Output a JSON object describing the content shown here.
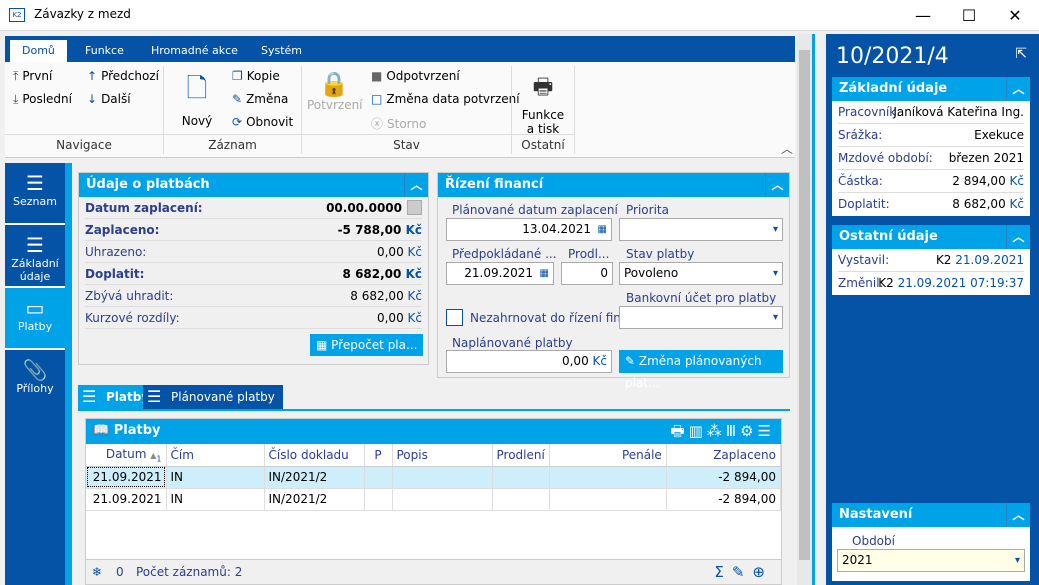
{
  "window": {
    "title": "Závazky z mezd",
    "minimize": "—",
    "maximize": "☐",
    "close": "✕"
  },
  "ribbon": {
    "tabs": [
      "Domů",
      "Funkce",
      "Hromadné akce",
      "Systém"
    ],
    "nav": {
      "first": "První",
      "last": "Poslední",
      "prev": "Předchozí",
      "next": "Další",
      "group": "Navigace"
    },
    "record": {
      "new": "Nový",
      "copy": "Kopie",
      "edit": "Změna",
      "refresh": "Obnovit",
      "group": "Záznam"
    },
    "state": {
      "confirm": "Potvrzení",
      "unconfirm": "Odpotvrzení",
      "change_date": "Změna data potvrzení",
      "cancel": "Storno",
      "group": "Stav"
    },
    "other": {
      "functions": "Funkce a tisk",
      "group": "Ostatní"
    }
  },
  "sidenav": [
    {
      "label": "Seznam",
      "icon": "hamburger-icon"
    },
    {
      "label": "Základní údaje",
      "icon": "list-icon"
    },
    {
      "label": "Platby",
      "icon": "box-icon",
      "active": true
    },
    {
      "label": "Přílohy",
      "icon": "paperclip-icon"
    }
  ],
  "payments": {
    "title": "Údaje o platbách",
    "rows": [
      {
        "label": "Datum zaplacení:",
        "value": "00.00.0000",
        "bold": true
      },
      {
        "label": "Zaplaceno:",
        "value": "-5 788,00",
        "unit": "Kč",
        "bold": true
      },
      {
        "label": "Uhrazeno:",
        "value": "0,00",
        "unit": "Kč"
      },
      {
        "label": "Doplatit:",
        "value": "8 682,00",
        "unit": "Kč",
        "bold": true
      },
      {
        "label": "Zbývá uhradit:",
        "value": "8 682,00",
        "unit": "Kč"
      },
      {
        "label": "Kurzové rozdíly:",
        "value": "0,00",
        "unit": "Kč"
      }
    ],
    "recalc": "Přepočet pla..."
  },
  "finance": {
    "title": "Řízení financí",
    "planned_date_label": "Plánované datum zaplacení",
    "planned_date": "13.04.2021",
    "priority_label": "Priorita",
    "priority": "",
    "expected_label": "Předpokládané ...",
    "expected": "21.09.2021",
    "delay_label": "Prodl...",
    "delay": "0",
    "status_label": "Stav platby",
    "status": "Povoleno",
    "exclude_label": "Nezahrnovat do řízení fin...",
    "exclude_checked": false,
    "bank_label": "Bankovní účet pro platby",
    "bank": "",
    "scheduled_label": "Naplánované platby",
    "scheduled": "0,00",
    "scheduled_unit": "Kč",
    "change_btn": "Změna plánovaných plat..."
  },
  "bottom_tabs": [
    "Platby",
    "Plánované platby"
  ],
  "grid": {
    "title": "Platby",
    "columns": [
      "Datum",
      "Čím",
      "Číslo dokladu",
      "P",
      "Popis",
      "Prodlení",
      "Penále",
      "Zaplaceno"
    ],
    "sort_index": "1",
    "rows": [
      [
        "21.09.2021",
        "IN",
        "IN/2021/2",
        "",
        "",
        "",
        "",
        "-2 894,00"
      ],
      [
        "21.09.2021",
        "IN",
        "IN/2021/2",
        "",
        "",
        "",
        "",
        "-2 894,00"
      ]
    ],
    "footer": {
      "filter_count": "0",
      "records": "Počet záznamů: 2"
    }
  },
  "right": {
    "title": "10/2021/4",
    "basic": {
      "title": "Základní údaje",
      "rows": [
        {
          "label": "Pracovník:",
          "value": "Janíková Kateřina Ing."
        },
        {
          "label": "Srážka:",
          "value": "Exekuce"
        },
        {
          "label": "Mzdové období:",
          "value": "březen 2021"
        },
        {
          "label": "Částka:",
          "value": "2 894,00",
          "unit": "Kč"
        },
        {
          "label": "Doplatit:",
          "value": "8 682,00",
          "unit": "Kč"
        }
      ]
    },
    "other": {
      "title": "Ostatní údaje",
      "created_label": "Vystavil:",
      "created_user": "K2",
      "created": "21.09.2021",
      "changed_label": "Změnil:",
      "changed_user": "K2",
      "changed": "21.09.2021 07:19:37"
    },
    "settings": {
      "title": "Nastavení",
      "period_label": "Období",
      "period": "2021"
    }
  },
  "colors": {
    "brand": "#0553a7",
    "accent": "#00a2e8",
    "selected_row": "#cdeefb"
  }
}
